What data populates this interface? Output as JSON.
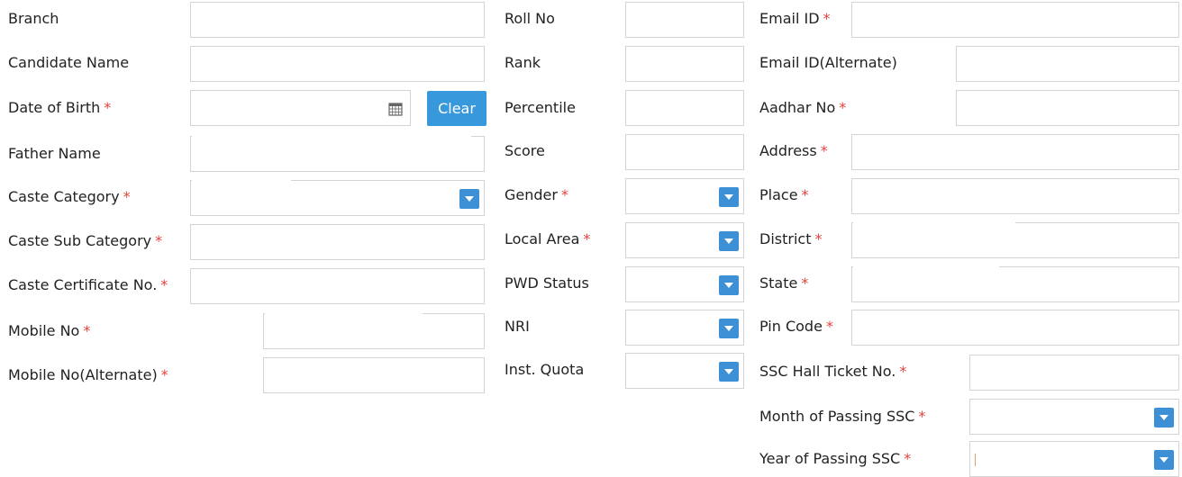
{
  "col1": {
    "branch": "Branch",
    "candidate_name": "Candidate Name",
    "dob": "Date of Birth",
    "clear": "Clear",
    "father_name": "Father Name",
    "caste_category": "Caste Category",
    "caste_sub_category": "Caste Sub Category",
    "caste_certificate": "Caste Certificate No.",
    "mobile": "Mobile No",
    "mobile_alt": "Mobile No(Alternate)"
  },
  "col2": {
    "roll_no": "Roll No",
    "rank": "Rank",
    "percentile": "Percentile",
    "score": "Score",
    "gender": "Gender",
    "local_area": "Local Area",
    "pwd_status": "PWD Status",
    "nri": "NRI",
    "inst_quota": "Inst. Quota"
  },
  "col3": {
    "email": "Email ID",
    "email_alt": "Email ID(Alternate)",
    "aadhar": "Aadhar No",
    "address": "Address",
    "place": "Place",
    "district": "District",
    "state": "State",
    "pin_code": "Pin Code",
    "ssc_hall_ticket": "SSC Hall Ticket No.",
    "month_ssc": "Month of Passing SSC",
    "year_ssc": "Year of Passing SSC"
  },
  "required_mark": "*",
  "colors": {
    "accent": "#3898dc",
    "required": "#e8403a",
    "border": "#d4d4d4"
  },
  "icons": {
    "calendar": "calendar-icon",
    "dropdown": "chevron-down-icon"
  }
}
